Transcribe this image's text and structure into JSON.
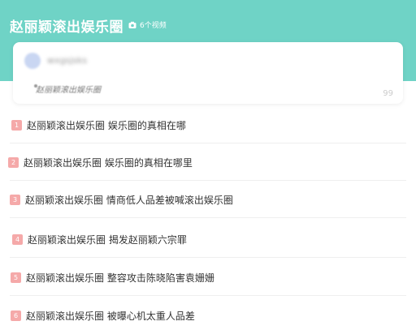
{
  "header": {
    "title": "赵丽颖滚出娱乐圈",
    "video_count": "6个视频"
  },
  "card": {
    "username": "wxgsjsks",
    "subtitle": "赵丽颖滚出娱乐圈",
    "quote_glyph": "99"
  },
  "topics": [
    {
      "rank": "1",
      "text": "赵丽颖滚出娱乐圈 娱乐圈的真相在哪"
    },
    {
      "rank": "2",
      "text": "赵丽颖滚出娱乐圈 娱乐圈的真相在哪里"
    },
    {
      "rank": "3",
      "text": "赵丽颖滚出娱乐圈 情商低人品差被喊滚出娱乐圈"
    },
    {
      "rank": "4",
      "text": "赵丽颖滚出娱乐圈 揭发赵丽颖六宗罪"
    },
    {
      "rank": "5",
      "text": "赵丽颖滚出娱乐圈 整容攻击陈晓陷害袁姗姗"
    },
    {
      "rank": "6",
      "text": "赵丽颖滚出娱乐圈 被曝心机太重人品差"
    }
  ],
  "colors": {
    "header_bg": "#6fd3c6",
    "badge_bg": "#f5a9a9"
  }
}
